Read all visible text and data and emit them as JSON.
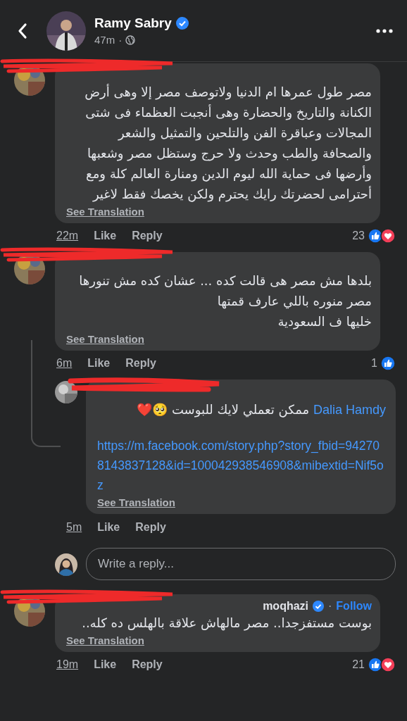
{
  "header": {
    "name": "Ramy Sabry",
    "verified": true,
    "time": "47m",
    "separator": "·"
  },
  "comments": [
    {
      "lines": [
        "مصر طول عمرها ام الدنيا ولاتوصف مصر إلا وهى أرض الكنانة والتاريخ والحضارة وهى أنجبت العظماء فى شتى المجالات وعباقرة الفن والتلحين والتمثيل والشعر والصحافة والطب وحدث ولا حرج وستظل مصر وشعبها وأرضها فى حماية الله ليوم الدين ومنارة العالم كلة ومع أحترامى لحضرتك رايك يحترم ولكن يخصك فقط لاغير"
      ],
      "see_translation": "See Translation",
      "time": "22m",
      "like": "Like",
      "reply": "Reply",
      "reaction_count": "23",
      "reactions": [
        {
          "kind": "like"
        },
        {
          "kind": "love"
        }
      ]
    },
    {
      "lines": [
        "بلدها مش مصر هى قالت كده ... عشان كده مش تنورها",
        "مصر منوره باللي عارف قمتها",
        "خليها ف السعودية"
      ],
      "see_translation": "See Translation",
      "time": "6m",
      "like": "Like",
      "reply": "Reply",
      "reaction_count": "1",
      "reactions": [
        {
          "kind": "like"
        }
      ],
      "replies": [
        {
          "mention": "Dalia Hamdy",
          "text": "ممكن تعملي لايك للبوست 🥺❤️",
          "link": "https://m.facebook.com/story.php?story_fbid=942708143837128&id=100042938546908&mibextid=Nif5oz",
          "see_translation": "See Translation",
          "time": "5m",
          "like": "Like",
          "reply": "Reply"
        }
      ],
      "reply_box": {
        "placeholder": "Write a reply..."
      }
    },
    {
      "name": "moqhazi",
      "verified": true,
      "follow_separator": "·",
      "follow": "Follow",
      "lines": [
        "بوست مستفزجدا.. مصر مالهاش علاقة بالهلس ده كله.."
      ],
      "see_translation": "See Translation",
      "time": "19m",
      "like": "Like",
      "reply": "Reply",
      "reaction_count": "21",
      "reactions": [
        {
          "kind": "like"
        },
        {
          "kind": "love"
        }
      ]
    }
  ]
}
